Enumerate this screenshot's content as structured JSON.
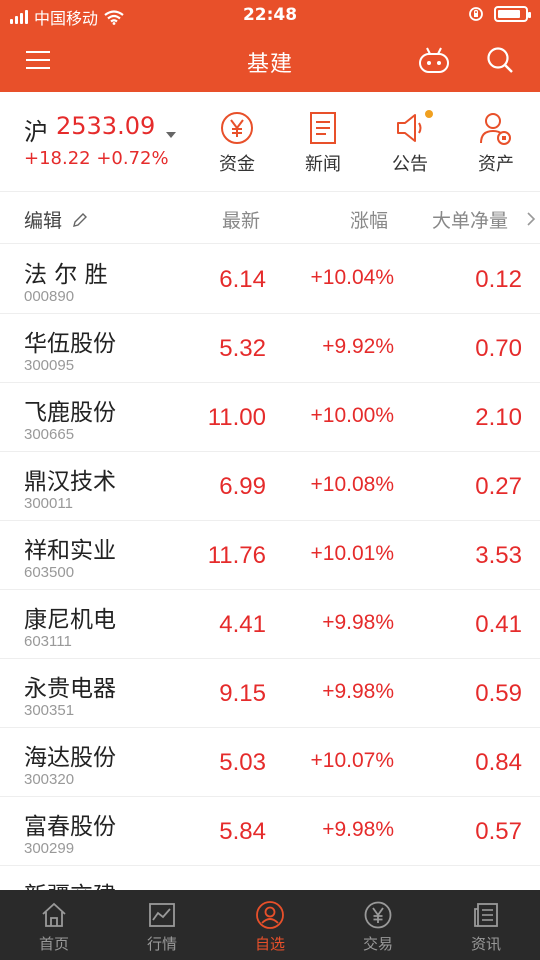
{
  "status_bar": {
    "carrier": "中国移动",
    "time": "22:48"
  },
  "nav": {
    "title": "基建"
  },
  "index": {
    "name": "沪",
    "value": "2533.09",
    "change": "+18.22 +0.72%"
  },
  "shortcuts": [
    {
      "label": "资金",
      "icon": "yuan-circle-icon"
    },
    {
      "label": "新闻",
      "icon": "document-icon"
    },
    {
      "label": "公告",
      "icon": "speaker-icon"
    },
    {
      "label": "资产",
      "icon": "user-asset-icon"
    }
  ],
  "columns": {
    "edit": "编辑",
    "latest": "最新",
    "change": "涨幅",
    "net_flow": "大单净量"
  },
  "stocks": [
    {
      "name": "法 尔 胜",
      "code": "000890",
      "price": "6.14",
      "change": "+10.04%",
      "net": "0.12"
    },
    {
      "name": "华伍股份",
      "code": "300095",
      "price": "5.32",
      "change": "+9.92%",
      "net": "0.70"
    },
    {
      "name": "飞鹿股份",
      "code": "300665",
      "price": "11.00",
      "change": "+10.00%",
      "net": "2.10"
    },
    {
      "name": "鼎汉技术",
      "code": "300011",
      "price": "6.99",
      "change": "+10.08%",
      "net": "0.27"
    },
    {
      "name": "祥和实业",
      "code": "603500",
      "price": "11.76",
      "change": "+10.01%",
      "net": "3.53"
    },
    {
      "name": "康尼机电",
      "code": "603111",
      "price": "4.41",
      "change": "+9.98%",
      "net": "0.41"
    },
    {
      "name": "永贵电器",
      "code": "300351",
      "price": "9.15",
      "change": "+9.98%",
      "net": "0.59"
    },
    {
      "name": "海达股份",
      "code": "300320",
      "price": "5.03",
      "change": "+10.07%",
      "net": "0.84"
    },
    {
      "name": "富春股份",
      "code": "300299",
      "price": "5.84",
      "change": "+9.98%",
      "net": "0.57"
    },
    {
      "name": "新疆交建",
      "code": "",
      "price": "",
      "change": "",
      "net": ""
    }
  ],
  "tabs": [
    {
      "label": "首页",
      "icon": "home-icon",
      "active": false
    },
    {
      "label": "行情",
      "icon": "market-chart-icon",
      "active": false
    },
    {
      "label": "自选",
      "icon": "watchlist-icon",
      "active": true
    },
    {
      "label": "交易",
      "icon": "trade-yuan-icon",
      "active": false
    },
    {
      "label": "资讯",
      "icon": "news-icon",
      "active": false
    }
  ],
  "colors": {
    "header_bg": "#e8502a",
    "up_red": "#e52b2b",
    "tabbar_bg": "#2a2a2a",
    "tab_active": "#e8502a",
    "notice_dot": "#f0a020"
  }
}
